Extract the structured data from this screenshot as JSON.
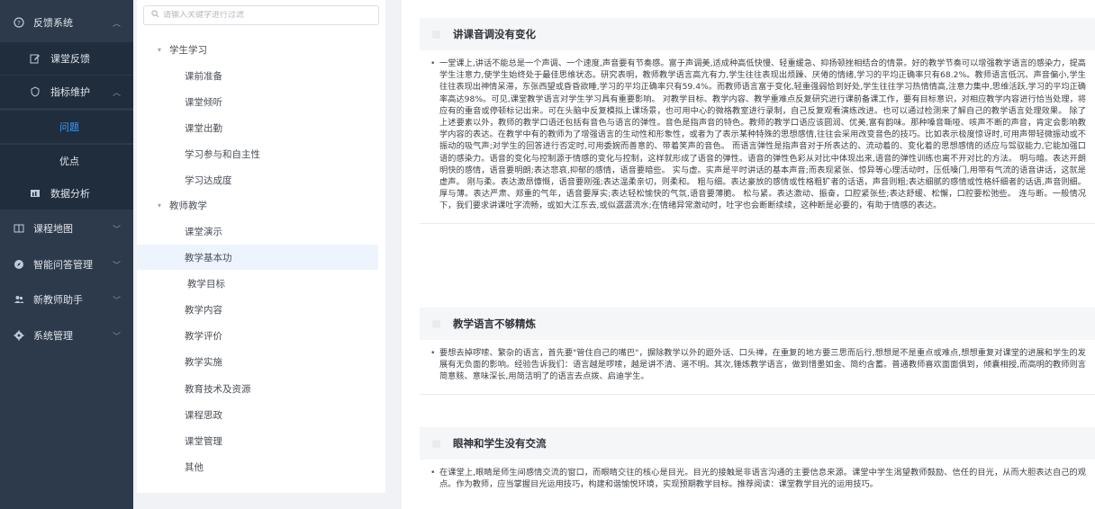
{
  "sidebar": {
    "feedback_system": "反馈系统",
    "class_feedback": "课堂反馈",
    "indicator_maintenance": "指标维护",
    "problem": "问题",
    "advantage": "优点",
    "data_analysis": "数据分析",
    "course_map": "课程地图",
    "qa_management": "智能问答管理",
    "new_teacher_assistant": "新教师助手",
    "system_management": "系统管理"
  },
  "tree": {
    "search_placeholder": "请输入关键字进行过滤",
    "groups": [
      {
        "label": "学生学习",
        "children": [
          "课前准备",
          "课堂倾听",
          "课堂出勤",
          "学习参与和自主性",
          "学习达成度"
        ]
      },
      {
        "label": "教师教学",
        "children": [
          "课堂演示",
          "教学基本功",
          "教学目标",
          "教学内容",
          "教学评价",
          "教学实施",
          "教育技术及资源",
          "课程思政",
          "课堂管理",
          "其他"
        ]
      }
    ]
  },
  "content": {
    "cards": [
      {
        "title": "讲课音调没有变化",
        "text": "一堂课上,讲话不能总是一个声调、一个速度,声音要有节奏感。富于声调美,适成种高低快慢、轻重缓急、抑扬顿挫相结合的情景。好的教学节奏可以增强教学语言的感染力，提高学生注意力,使学生始终处于最佳思维状态。研究表明，教师教学语言高亢有力,学生往往表现出烦躁、厌倦的情绪,学习的平均正确率只有68.2%。教师语言低沉、声音偏小,学生往往表现出神情呆滞，东张西望或昏昏欲睡,学习的平均正确率只有59.4%。而教师语言富于变化,轻重强弱恰到好处,学生往往学习热情情高,注意力集中,思维活跃,学习的平均正确率高达98%。可见,课堂教学语言对学生学习具有重要影响。 对教学目标、教学内容、教学重难点反复研究进行课前备课工作，要有目标意识，对相应教学内容进行恰当处理，将应有的重音或停顿标记出来。可在头脑中反复模拟上课场景，也可用中心的微格教室进行录制，自己反复观看演练改进。也可以通过检测来了解自己的教学语言处理效果。 除了上述要素以外，教师的教学口语还包括有音色与语言的弹性。音色是指声音的特色。教师的教学口语应该圆润、优美,富有韵味。那种嗓音嘶哑、咳声不断的声音，肯定会影响教学内容的表达。在教学中有的教师为了增强语言的生动性和形象性，或者为了表示某种特殊的思想感情,往往会采用改变音色的技巧。比如表示极度惊讶时,可用声带轻微振动或不振动的吸气声;对学生的回答进行否定时,可用委婉而善意的、带着笑声的音色。 而语言弹性是指声音对于所表达的、流动着的、变化着的思想感情的适应与驾驭能力,它能加强口语的感染力。语音的变化与控制源于情感的变化与控制，这样就形成了语音的弹性。语音的弹性色彩从对比中体现出来,语音的弹性训练也离不开对比的方法。 明与暗。表达开朗明快的感情，语音要明朗;表达悲哀,抑郁的感情，语音要暗些。 实与虚。实声是平时讲话的基本声音;而表现紧张、惊异等心理活动时，压低嗓门,用带有气流的语音讲话，这就是虚声。 刚与柔。表达激昂慷慨，语音要刚强;表达温柔亲切，则柔和。 粗与细。表达豪放的感情或性格粗犷者的话语，声音则粗;表达细腻的感情或性格纤细者的话语,声音则细。 厚与薄。表达严肃、郑重的气年，语音要厚实;表达轻松愉快的气氛,语音要薄脆。 松与紧。表达激动、振奋，口腔紧张些;表达舒缓、松懈，口腔要松弛些。 连与断。一般情况下，我们要求讲课吐字流畅，或如大江东去,或似潺潺流水;在情绪异常激动时，吐字也会断断续续，这种断是必要的，有助于情感的表达。"
      },
      {
        "title": "教学语言不够精炼",
        "text": "要想去掉啰嗦、繁杂的语言，首先要\"管住自己的嘴巴\"，摒除教学以外的题外话、口头禅，在重复的地方要三思而后行,想想是不是重点或难点,想想重复对课堂的进展和学生的发展有无负面的影响。经验告诉我们：语言越是啰嗦，越是讲不清、道不明。其次,锤炼教学语言，做到惜墨如金、简约含蓄。普通教师喜欢面面俱到，倾囊相授,而高明的教师则言简意赅、意味深长,用简洁明了的语言去点拨、启迪学生。"
      },
      {
        "title": "眼神和学生没有交流",
        "text": "在课堂上,眼睛是师生间感情交流的窗口，而眼睛交往的核心是目光。目光的接触是非语言沟通的主要信息来源。课堂中学生渴望教师鼓励、信任的目光，从而大胆表达自己的观点。作为教师，应当掌握目光运用技巧，构建和谐愉悦环境，实现预期教学目标。推荐阅读：课堂教学目光的运用技巧。"
      }
    ]
  },
  "colors": {
    "sidebar_bg": "#2d3a4b",
    "sidebar_sub_bg": "#1f2d3d",
    "active_accent": "#409eff"
  }
}
